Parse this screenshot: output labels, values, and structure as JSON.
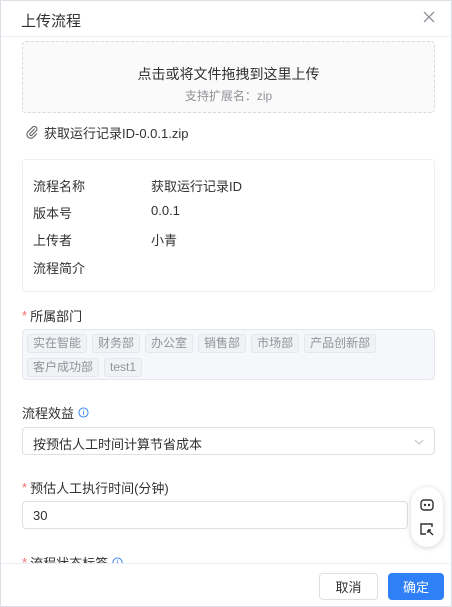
{
  "dialog": {
    "title": "上传流程",
    "close_icon": "close-icon"
  },
  "upload": {
    "main_text": "点击或将文件拖拽到这里上传",
    "tip_text": "支持扩展名：zip"
  },
  "file": {
    "icon": "paperclip-icon",
    "name": "获取运行记录ID-0.0.1.zip"
  },
  "info": {
    "rows": [
      {
        "key": "流程名称",
        "value": "获取运行记录ID"
      },
      {
        "key": "版本号",
        "value": "0.0.1"
      },
      {
        "key": "上传者",
        "value": "小青"
      },
      {
        "key": "流程简介",
        "value": ""
      }
    ]
  },
  "department": {
    "required_mark": "*",
    "label": "所属部门",
    "tags": [
      "实在智能",
      "财务部",
      "办公室",
      "销售部",
      "市场部",
      "产品创新部",
      "客户成功部",
      "test1"
    ]
  },
  "benefit": {
    "label": "流程效益",
    "info_icon": "info-circle-icon",
    "selected": "按预估人工时间计算节省成本",
    "arrow_icon": "chevron-down-icon"
  },
  "time": {
    "required_mark": "*",
    "label": "预估人工执行时间(分钟)",
    "value": "30"
  },
  "status_tag": {
    "required_mark": "*",
    "label": "流程状态标签"
  },
  "footer": {
    "cancel_label": "取消",
    "ok_label": "确定"
  },
  "float_toolbar": {
    "icons": [
      "robot-icon",
      "feedback-icon"
    ]
  },
  "colors": {
    "primary": "#2f7ff6",
    "required": "#f56c6c",
    "muted": "#909399"
  }
}
